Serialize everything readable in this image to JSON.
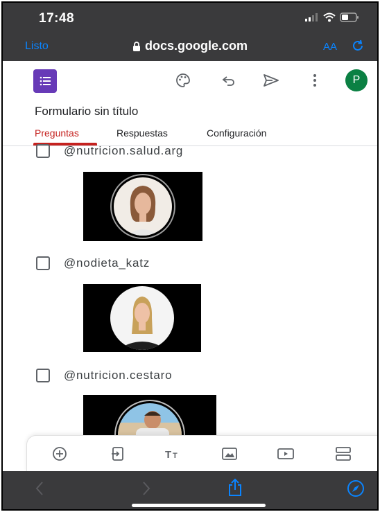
{
  "status": {
    "time": "17:48"
  },
  "browser": {
    "done_label": "Listo",
    "url": "docs.google.com",
    "text_size_label": "AA"
  },
  "form": {
    "title": "Formulario sin título",
    "tabs": [
      {
        "label": "Preguntas",
        "active": true
      },
      {
        "label": "Respuestas",
        "active": false
      },
      {
        "label": "Configuración",
        "active": false
      }
    ],
    "options": [
      {
        "label": "@nutricion.salud.arg"
      },
      {
        "label": "@nodieta_katz"
      },
      {
        "label": "@nutricion.cestaro"
      }
    ],
    "avatar_initial": "P"
  },
  "bottom_toolbar": [
    "add-question-icon",
    "import-questions-icon",
    "add-title-icon",
    "add-image-icon",
    "add-video-icon",
    "add-section-icon"
  ],
  "colors": {
    "forms_purple": "#673ab7",
    "active_tab": "#c5221f",
    "ios_blue": "#0a84ff",
    "avatar_green": "#0b8043",
    "browser_chrome": "#3a3a3c"
  }
}
